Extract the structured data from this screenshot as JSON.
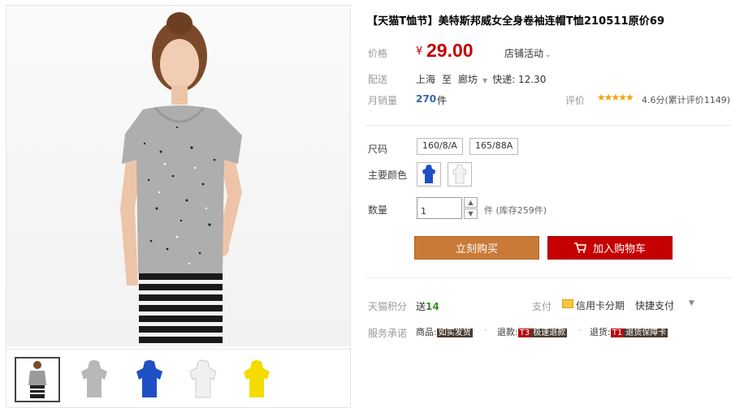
{
  "product": {
    "title": "【天猫T恤节】美特斯邦威女全身卷袖连帽T恤210511原价69"
  },
  "price": {
    "label": "价格",
    "currency": "¥",
    "value": "29.00",
    "promo_label": "店铺活动"
  },
  "shipping": {
    "label": "配送",
    "from": "上海",
    "to_word": "至",
    "destination": "廊坊",
    "express": "快递: 12.30"
  },
  "sales": {
    "label": "月销量",
    "count": "270",
    "unit": "件"
  },
  "rating": {
    "label": "评价",
    "stars": "★★★★★",
    "text": "4.6分(累计评价1149)"
  },
  "options": {
    "size_label": "尺码",
    "sizes": [
      "160/8/A",
      "165/88A"
    ],
    "color_label": "主要颜色",
    "colors": [
      "#1e4fc4",
      "#f2f2f2"
    ]
  },
  "quantity": {
    "label": "数量",
    "value": "1",
    "up": "▲",
    "down": "▼",
    "stock": "件 (库存259件)"
  },
  "buttons": {
    "buy_now": "立刻购买",
    "add_cart": "加入购物车"
  },
  "points": {
    "label": "天猫积分",
    "prefix": "送",
    "value": "14"
  },
  "payment": {
    "label": "支付",
    "credit": "信用卡分期",
    "quick": "快捷支付"
  },
  "service": {
    "label": "服务承诺",
    "items": [
      {
        "prefix": "商品:",
        "tag": "如实发货"
      },
      {
        "prefix": "退款:",
        "tag_code": "T3",
        "tag": "极速退款"
      },
      {
        "prefix": "退货:",
        "tag_code": "T1",
        "tag": "退货保障卡"
      }
    ]
  },
  "gallery": {
    "thumb_colors": [
      "#9a9a9a",
      "#b8b8b8",
      "#1e4fc4",
      "#f0f0f0",
      "#f4dc00"
    ]
  }
}
